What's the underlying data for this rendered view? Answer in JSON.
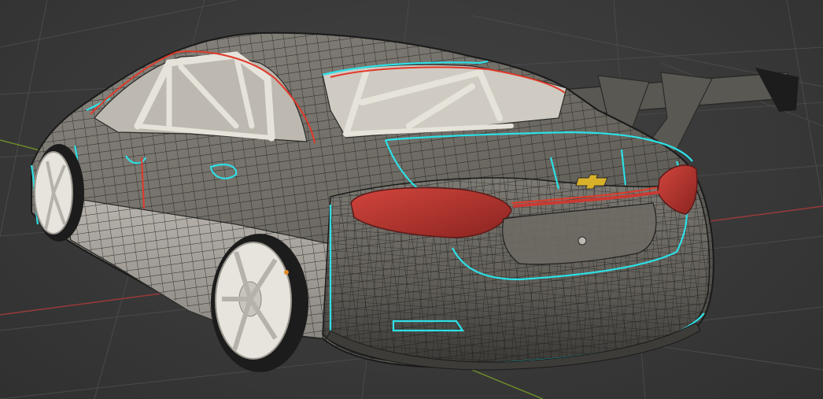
{
  "viewport": {
    "background": "#3a3a3a",
    "grid_color": "#4a4a4a",
    "axis_x_color": "#9a3a3a",
    "axis_y_color": "#6a8a2a"
  },
  "model": {
    "body_color": "#6d6a63",
    "wire_color": "#1b1b1b",
    "seam_color": "#2de0e6",
    "crease_color": "#e03a2a",
    "taillight_color": "#b8312c",
    "rollcage_color": "#e6e3da",
    "interior_color": "#cfcbc2",
    "wheel_color": "#e7e4dd",
    "wing_color": "#5a5853",
    "emblem_color": "#d8b12a"
  }
}
